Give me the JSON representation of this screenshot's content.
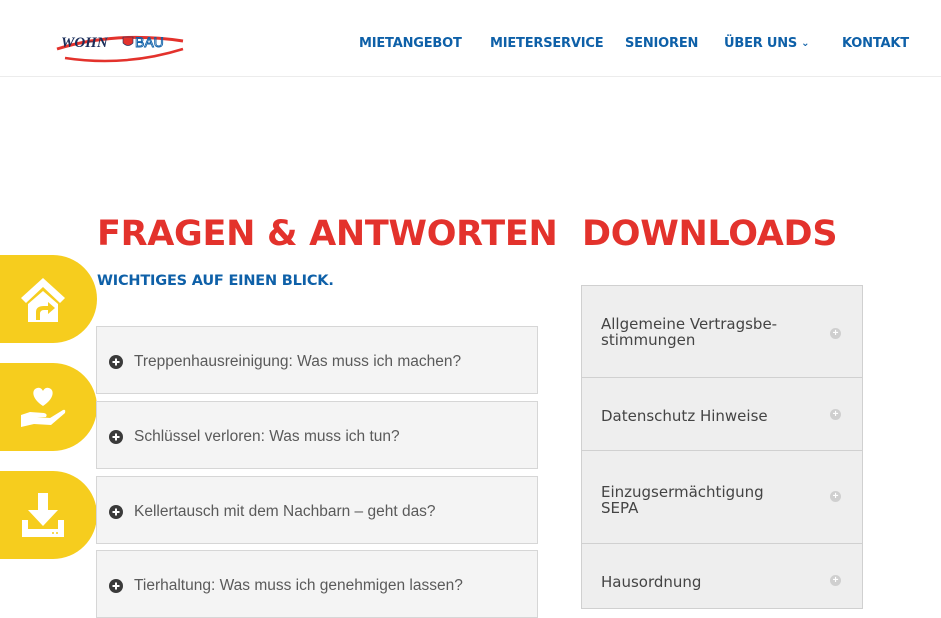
{
  "header": {
    "logo": {
      "left": "WOHN",
      "right": "BAU"
    },
    "nav": [
      {
        "label": "MIETANGEBOT"
      },
      {
        "label": "MIETERSERVICE"
      },
      {
        "label": "SENIOREN"
      },
      {
        "label": "ÜBER UNS"
      },
      {
        "label": "KONTAKT"
      }
    ]
  },
  "side_tabs": [
    {
      "icon": "home-icon"
    },
    {
      "icon": "hand-heart-icon"
    },
    {
      "icon": "download-icon"
    }
  ],
  "faq": {
    "title": "FRAGEN & ANTWORTEN",
    "subtitle": "WICHTIGES AUF EINEN BLICK.",
    "items": [
      "Treppenhausreinigung: Was muss ich machen?",
      "Schlüssel verloren: Was muss ich tun?",
      "Kellertausch mit dem Nachbarn – geht das?",
      "Tierhaltung: Was muss ich genehmigen lassen?"
    ]
  },
  "downloads": {
    "title": "DOWNLOADS",
    "items": [
      {
        "line1": "Allgemeine Vertragsbe-",
        "line2": "stimmungen"
      },
      {
        "line1": "Datenschutz Hinweise",
        "line2": ""
      },
      {
        "line1": "Einzugsermächtigung",
        "line2": "SEPA"
      },
      {
        "line1": "Hausordnung",
        "line2": ""
      }
    ]
  },
  "colors": {
    "brand_blue": "#0e60a8",
    "brand_red": "#e3322c",
    "accent_yellow": "#f6cd1e"
  }
}
